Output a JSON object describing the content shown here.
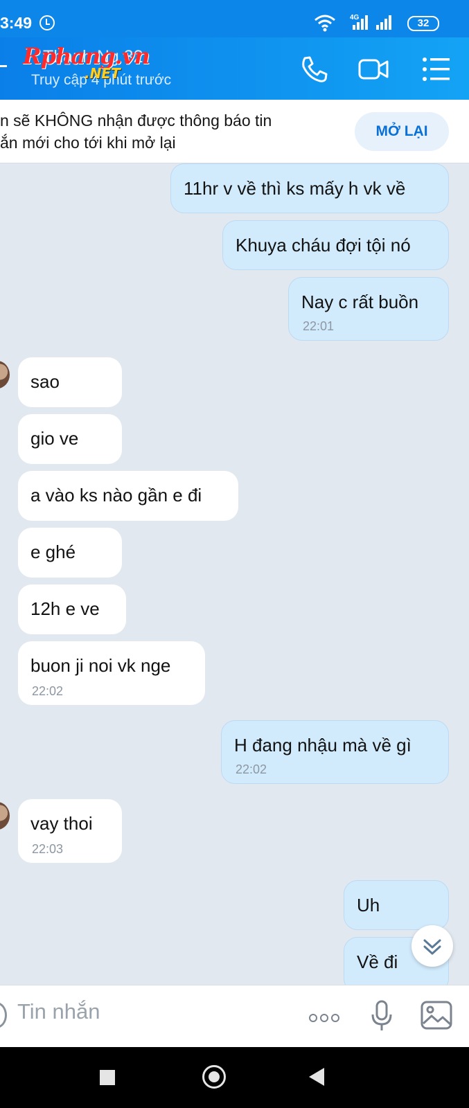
{
  "status_bar": {
    "time": "3:49",
    "network": "4G",
    "battery": "32"
  },
  "header": {
    "contact_name": "Thanh Ng 32",
    "last_seen": "Truy cập 4 phút trước",
    "watermark": "Rphang.vn",
    "watermark_sub": ".NET"
  },
  "notice": {
    "text": "n sẽ KHÔNG nhận được thông báo tin\nắn mới cho tới khi mở lại",
    "button": "MỞ LẠI"
  },
  "messages": [
    {
      "dir": "out",
      "text": "11hr v về thì ks mấy h vk về",
      "time": ""
    },
    {
      "dir": "out",
      "text": "Khuya cháu đợi tội nó",
      "time": ""
    },
    {
      "dir": "out",
      "text": "Nay c rất buồn",
      "time": "22:01"
    },
    {
      "dir": "in",
      "text": "sao",
      "time": "",
      "avatar": true
    },
    {
      "dir": "in",
      "text": "gio ve",
      "time": ""
    },
    {
      "dir": "in",
      "text": "a vào ks nào gần e đi",
      "time": ""
    },
    {
      "dir": "in",
      "text": "e ghé",
      "time": ""
    },
    {
      "dir": "in",
      "text": "12h e ve",
      "time": ""
    },
    {
      "dir": "in",
      "text": "buon ji noi vk nge",
      "time": "22:02"
    },
    {
      "dir": "out",
      "text": "H đang nhậu mà về gì",
      "time": "22:02"
    },
    {
      "dir": "in",
      "text": "vay thoi",
      "time": "22:03",
      "avatar": true
    },
    {
      "dir": "out",
      "text": "Uh",
      "time": ""
    },
    {
      "dir": "out",
      "text": "Về đi",
      "time": ""
    }
  ],
  "input": {
    "placeholder": "Tin nhắn"
  },
  "colors": {
    "accent": "#0b70d6",
    "header": "#0d86ea",
    "outgoing_bubble": "#d2ebfc",
    "chat_background": "#e2e8f0"
  }
}
